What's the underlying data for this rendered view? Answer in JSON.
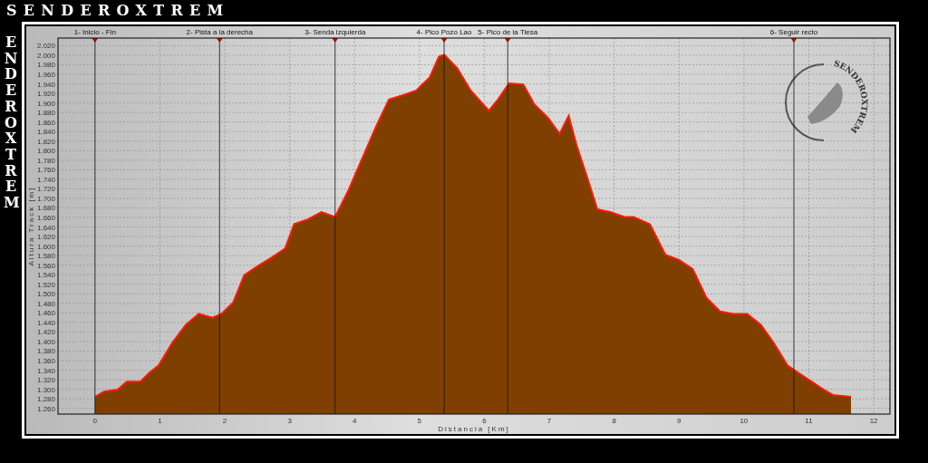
{
  "title": {
    "horizontal": "SENDEROXTREM",
    "vertical": "ENDEROXTREM"
  },
  "logo": {
    "text": "SENDEROXTREM"
  },
  "chart": {
    "chart_data": {
      "type": "area",
      "xlabel": "Distancia [Km]",
      "ylabel": "Altura Track [m]",
      "x": [
        0,
        0.14,
        0.35,
        0.49,
        0.7,
        0.84,
        0.98,
        1.19,
        1.4,
        1.6,
        1.81,
        1.95,
        2.13,
        2.3,
        2.51,
        2.72,
        2.93,
        3.07,
        3.28,
        3.49,
        3.7,
        3.91,
        4.12,
        4.33,
        4.53,
        4.74,
        4.95,
        5.16,
        5.3,
        5.38,
        5.58,
        5.79,
        6.07,
        6.21,
        6.38,
        6.6,
        6.77,
        6.98,
        7.16,
        7.3,
        7.42,
        7.58,
        7.74,
        7.95,
        8.16,
        8.3,
        8.55,
        8.79,
        9.0,
        9.21,
        9.42,
        9.63,
        9.84,
        10.05,
        10.26,
        10.46,
        10.67,
        10.81,
        11.02,
        11.23,
        11.37,
        11.65
      ],
      "series": [
        {
          "color": "#7f3f00",
          "values": [
            1284,
            1295,
            1299,
            1316,
            1316,
            1335,
            1350,
            1397,
            1435,
            1458,
            1450,
            1458,
            1482,
            1539,
            1558,
            1576,
            1595,
            1646,
            1656,
            1671,
            1661,
            1718,
            1784,
            1850,
            1907,
            1916,
            1926,
            1954,
            1997,
            2001,
            1973,
            1926,
            1884,
            1907,
            1941,
            1939,
            1897,
            1869,
            1835,
            1873,
            1812,
            1746,
            1677,
            1671,
            1661,
            1661,
            1646,
            1582,
            1571,
            1552,
            1492,
            1463,
            1458,
            1458,
            1435,
            1397,
            1350,
            1337,
            1318,
            1299,
            1288,
            1284
          ]
        }
      ],
      "grid": true,
      "xlim": [
        -0.57,
        12.25
      ],
      "ylim": [
        1248,
        2036
      ],
      "xticks": [
        0,
        1,
        2,
        3,
        4,
        5,
        6,
        7,
        8,
        9,
        10,
        11,
        12
      ],
      "yticks": [
        {
          "value": 2020,
          "label": "2.020"
        },
        {
          "value": 2000,
          "label": "2.000"
        },
        {
          "value": 1980,
          "label": "1.980"
        },
        {
          "value": 1960,
          "label": "1.960"
        },
        {
          "value": 1940,
          "label": "1.940"
        },
        {
          "value": 1920,
          "label": "1.920"
        },
        {
          "value": 1900,
          "label": "1.900"
        },
        {
          "value": 1880,
          "label": "1.880"
        },
        {
          "value": 1860,
          "label": "1.860"
        },
        {
          "value": 1840,
          "label": "1.840"
        },
        {
          "value": 1820,
          "label": "1.820"
        },
        {
          "value": 1800,
          "label": "1.800"
        },
        {
          "value": 1780,
          "label": "1.780"
        },
        {
          "value": 1760,
          "label": "1.760"
        },
        {
          "value": 1740,
          "label": "1.740"
        },
        {
          "value": 1720,
          "label": "1.720"
        },
        {
          "value": 1700,
          "label": "1.700"
        },
        {
          "value": 1680,
          "label": "1.680"
        },
        {
          "value": 1660,
          "label": "1.660"
        },
        {
          "value": 1640,
          "label": "1.640"
        },
        {
          "value": 1620,
          "label": "1.620"
        },
        {
          "value": 1600,
          "label": "1.600"
        },
        {
          "value": 1580,
          "label": "1.580"
        },
        {
          "value": 1560,
          "label": "1.560"
        },
        {
          "value": 1540,
          "label": "1.540"
        },
        {
          "value": 1520,
          "label": "1.520"
        },
        {
          "value": 1500,
          "label": "1.500"
        },
        {
          "value": 1480,
          "label": "1.480"
        },
        {
          "value": 1460,
          "label": "1.460"
        },
        {
          "value": 1440,
          "label": "1.440"
        },
        {
          "value": 1420,
          "label": "1.420"
        },
        {
          "value": 1400,
          "label": "1.400"
        },
        {
          "value": 1380,
          "label": "1.380"
        },
        {
          "value": 1360,
          "label": "1.360"
        },
        {
          "value": 1340,
          "label": "1.340"
        },
        {
          "value": 1320,
          "label": "1.320"
        },
        {
          "value": 1300,
          "label": "1.300"
        },
        {
          "value": 1280,
          "label": "1.280"
        },
        {
          "value": 1260,
          "label": "1.260"
        }
      ],
      "annotations": [
        {
          "x": 0,
          "text": "1- Inicio - Fin"
        },
        {
          "x": 1.92,
          "text": "2- Pista a la derecha"
        },
        {
          "x": 3.7,
          "text": "3- Senda izquierda"
        },
        {
          "x": 5.38,
          "text": "4- Pico Pozo Lao"
        },
        {
          "x": 6.36,
          "text": "5- Pico de la Tiesa"
        },
        {
          "x": 10.77,
          "text": "6- Seguir recto"
        }
      ]
    }
  }
}
